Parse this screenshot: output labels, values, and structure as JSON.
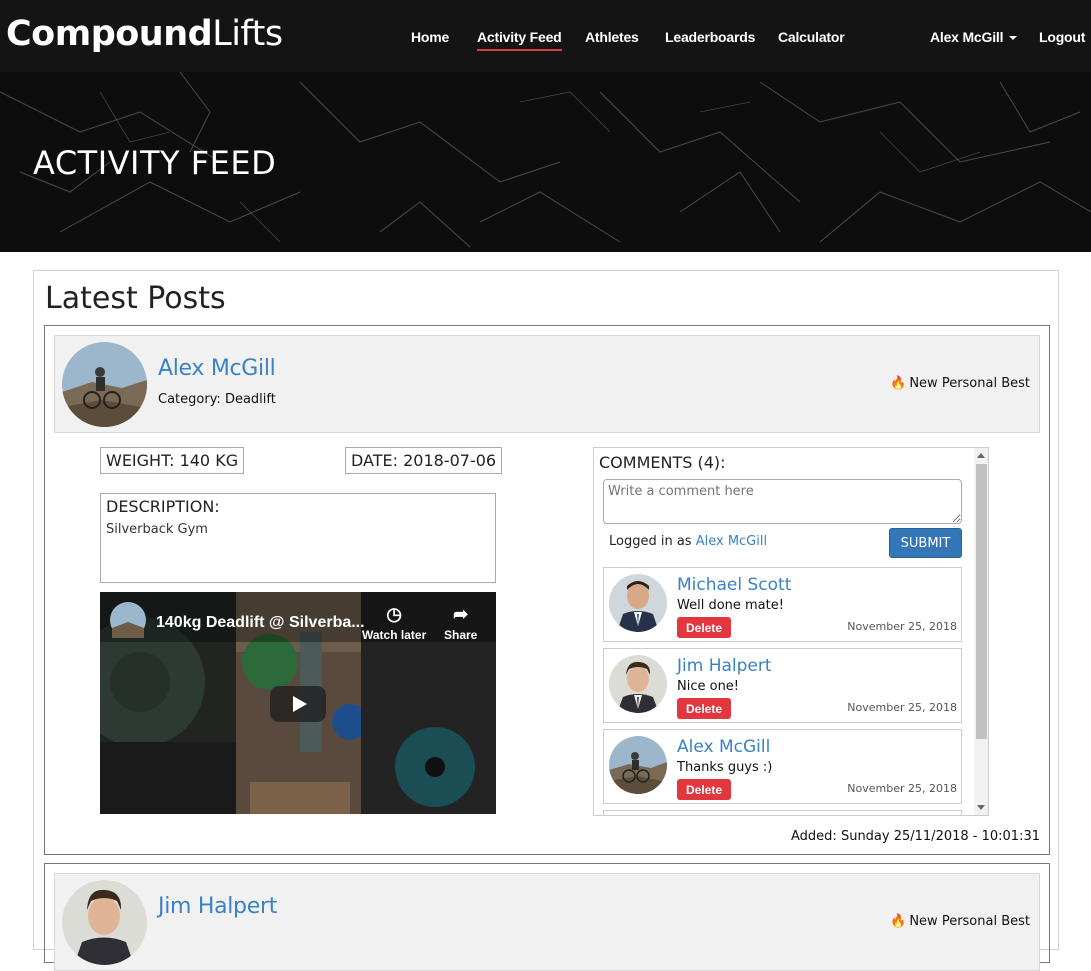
{
  "nav": {
    "brand_bold": "Compound",
    "brand_light": "Lifts",
    "items": [
      "Home",
      "Activity Feed",
      "Athletes",
      "Leaderboards",
      "Calculator"
    ],
    "user": "Alex McGill",
    "logout": "Logout",
    "accent_color": "#e23a44"
  },
  "hero": {
    "title": "ACTIVITY FEED"
  },
  "main": {
    "heading": "Latest Posts"
  },
  "posts": [
    {
      "author": "Alex McGill",
      "category": "Category: Deadlift",
      "badge": "New Personal Best",
      "badge_icon": "fire-icon",
      "weight": "WEIGHT: 140 KG",
      "date": "DATE: 2018-07-06",
      "description_label": "DESCRIPTION:",
      "description": "Silverback Gym",
      "video": {
        "title": "140kg Deadlift @ Silverba...",
        "watch_later": "Watch later",
        "share": "Share"
      },
      "comments": {
        "header": "COMMENTS (4):",
        "placeholder": "Write a comment here",
        "logged_in_prefix": "Logged in as",
        "logged_in_user": "Alex McGill",
        "submit": "SUBMIT",
        "items": [
          {
            "name": "Michael Scott",
            "text": "Well done mate!",
            "delete": "Delete",
            "date": "November 25, 2018"
          },
          {
            "name": "Jim Halpert",
            "text": "Nice one!",
            "delete": "Delete",
            "date": "November 25, 2018"
          },
          {
            "name": "Alex McGill",
            "text": "Thanks guys :)",
            "delete": "Delete",
            "date": "November 25, 2018"
          }
        ]
      },
      "added": "Added: Sunday 25/11/2018 - 10:01:31"
    },
    {
      "author": "Jim Halpert",
      "badge": "New Personal Best",
      "badge_icon": "fire-icon"
    }
  ]
}
